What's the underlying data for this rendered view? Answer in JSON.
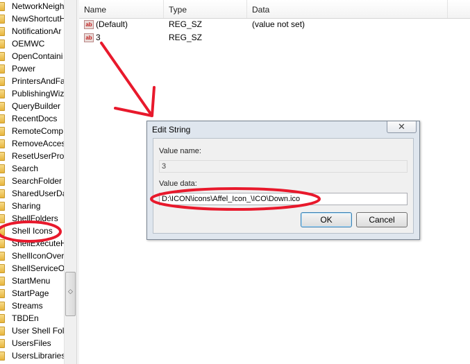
{
  "tree": {
    "items": [
      "NetworkNeigh",
      "NewShortcutH",
      "NotificationAr",
      "OEMWC",
      "OpenContaini",
      "Power",
      "PrintersAndFa",
      "PublishingWiz",
      "QueryBuilder",
      "RecentDocs",
      "RemoteComp",
      "RemoveAcces",
      "ResetUserProf",
      "Search",
      "SearchFolder",
      "SharedUserDa",
      "Sharing",
      "ShellFolders",
      "Shell Icons",
      "ShellExecuteH",
      "ShellIconOver",
      "ShellServiceOb",
      "StartMenu",
      "StartPage",
      "Streams",
      "TBDEn",
      "User Shell Folc",
      "UsersFiles",
      "UsersLibraries"
    ],
    "icon": "folder-icon"
  },
  "list": {
    "columns": [
      "Name",
      "Type",
      "Data"
    ],
    "rows": [
      {
        "name": "(Default)",
        "type": "REG_SZ",
        "data": "(value not set)",
        "icon": "string-value-icon"
      },
      {
        "name": "3",
        "type": "REG_SZ",
        "data": "",
        "icon": "string-value-icon"
      }
    ]
  },
  "dialog": {
    "title": "Edit String",
    "close_glyph": "✕",
    "value_name_label": "Value name:",
    "value_name": "3",
    "value_data_label": "Value data:",
    "value_data": "D:\\ICON\\icons\\Affel_Icon_\\ICO\\Down.ico",
    "ok_label": "OK",
    "cancel_label": "Cancel"
  },
  "annotation_color": "#e8192c"
}
